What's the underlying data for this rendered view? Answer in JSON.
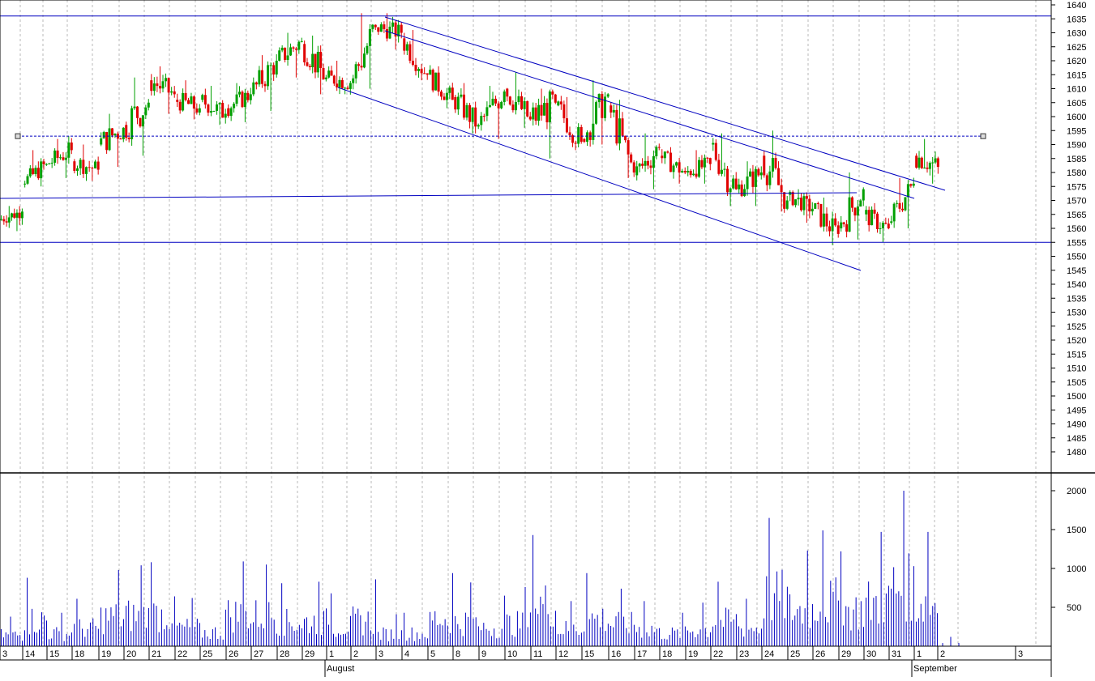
{
  "chart_data": [
    {
      "type": "candlestick",
      "panel": "price",
      "yticks": [
        1640,
        1635,
        1630,
        1625,
        1620,
        1615,
        1610,
        1605,
        1600,
        1595,
        1590,
        1585,
        1580,
        1575,
        1570,
        1565,
        1560,
        1555,
        1550,
        1545,
        1540,
        1535,
        1530,
        1525,
        1520,
        1515,
        1510,
        1505,
        1500,
        1495,
        1490,
        1485,
        1480
      ],
      "ylim": [
        1475,
        1641
      ],
      "day_labels": [
        "3",
        "14",
        "15",
        "18",
        "19",
        "20",
        "21",
        "22",
        "25",
        "26",
        "27",
        "28",
        "29",
        "1",
        "2",
        "3",
        "4",
        "5",
        "8",
        "9",
        "10",
        "11",
        "12",
        "15",
        "16",
        "17",
        "18",
        "19",
        "22",
        "23",
        "24",
        "25",
        "26",
        "29",
        "30",
        "31",
        "1",
        "2",
        "3"
      ],
      "month_labels": [
        "August",
        "September"
      ],
      "daily_ohlc": [
        {
          "d": "13",
          "o": 1563,
          "h": 1568,
          "l": 1559,
          "c": 1566
        },
        {
          "d": "14",
          "o": 1576,
          "h": 1588,
          "l": 1575,
          "c": 1583
        },
        {
          "d": "15",
          "o": 1583,
          "h": 1592,
          "l": 1578,
          "c": 1588
        },
        {
          "d": "18",
          "o": 1584,
          "h": 1590,
          "l": 1577,
          "c": 1581
        },
        {
          "d": "19",
          "o": 1590,
          "h": 1601,
          "l": 1582,
          "c": 1596
        },
        {
          "d": "20",
          "o": 1597,
          "h": 1614,
          "l": 1586,
          "c": 1605
        },
        {
          "d": "21",
          "o": 1613,
          "h": 1618,
          "l": 1601,
          "c": 1608
        },
        {
          "d": "22",
          "o": 1606,
          "h": 1613,
          "l": 1599,
          "c": 1603
        },
        {
          "d": "25",
          "o": 1606,
          "h": 1611,
          "l": 1597,
          "c": 1601
        },
        {
          "d": "26",
          "o": 1603,
          "h": 1612,
          "l": 1598,
          "c": 1608
        },
        {
          "d": "27",
          "o": 1608,
          "h": 1622,
          "l": 1602,
          "c": 1620
        },
        {
          "d": "28",
          "o": 1620,
          "h": 1630,
          "l": 1614,
          "c": 1627
        },
        {
          "d": "29",
          "o": 1626,
          "h": 1629,
          "l": 1608,
          "c": 1614
        },
        {
          "d": "1",
          "o": 1614,
          "h": 1620,
          "l": 1608,
          "c": 1612
        },
        {
          "d": "2",
          "o": 1612,
          "h": 1637,
          "l": 1610,
          "c": 1632
        },
        {
          "d": "3",
          "o": 1632,
          "h": 1637,
          "l": 1624,
          "c": 1630
        },
        {
          "d": "4",
          "o": 1628,
          "h": 1631,
          "l": 1613,
          "c": 1615
        },
        {
          "d": "5",
          "o": 1615,
          "h": 1618,
          "l": 1603,
          "c": 1606
        },
        {
          "d": "8",
          "o": 1607,
          "h": 1612,
          "l": 1594,
          "c": 1597
        },
        {
          "d": "9",
          "o": 1597,
          "h": 1611,
          "l": 1592,
          "c": 1609
        },
        {
          "d": "10",
          "o": 1610,
          "h": 1616,
          "l": 1596,
          "c": 1599
        },
        {
          "d": "11",
          "o": 1599,
          "h": 1610,
          "l": 1585,
          "c": 1605
        },
        {
          "d": "12",
          "o": 1604,
          "h": 1607,
          "l": 1588,
          "c": 1591
        },
        {
          "d": "15",
          "o": 1592,
          "h": 1613,
          "l": 1590,
          "c": 1608
        },
        {
          "d": "16",
          "o": 1604,
          "h": 1606,
          "l": 1578,
          "c": 1580
        },
        {
          "d": "17",
          "o": 1579,
          "h": 1594,
          "l": 1574,
          "c": 1589
        },
        {
          "d": "18",
          "o": 1586,
          "h": 1589,
          "l": 1576,
          "c": 1580
        },
        {
          "d": "19",
          "o": 1580,
          "h": 1588,
          "l": 1576,
          "c": 1583
        },
        {
          "d": "22",
          "o": 1590,
          "h": 1594,
          "l": 1568,
          "c": 1574
        },
        {
          "d": "23",
          "o": 1574,
          "h": 1584,
          "l": 1568,
          "c": 1580
        },
        {
          "d": "24",
          "o": 1586,
          "h": 1595,
          "l": 1566,
          "c": 1570
        },
        {
          "d": "25",
          "o": 1572,
          "h": 1574,
          "l": 1562,
          "c": 1567
        },
        {
          "d": "26",
          "o": 1567,
          "h": 1571,
          "l": 1554,
          "c": 1558
        },
        {
          "d": "29",
          "o": 1560,
          "h": 1580,
          "l": 1556,
          "c": 1574
        },
        {
          "d": "30",
          "o": 1565,
          "h": 1569,
          "l": 1555,
          "c": 1560
        },
        {
          "d": "31",
          "o": 1562,
          "h": 1578,
          "l": 1560,
          "c": 1576
        },
        {
          "d": "1",
          "o": 1586,
          "h": 1592,
          "l": 1576,
          "c": 1582
        }
      ],
      "horizontal_levels": [
        1636,
        1555
      ],
      "dotted_level": 1593,
      "series_colors": {
        "up": "#00a000",
        "down": "#e00000",
        "lines": "#0000c0",
        "grid": "#b0b0b0"
      }
    },
    {
      "type": "bar",
      "panel": "volume",
      "yticks": [
        2000,
        1500,
        1000,
        500
      ],
      "ylim": [
        0,
        2200
      ],
      "daily_volume_peaks": [
        {
          "d": "13",
          "v": 380
        },
        {
          "d": "14",
          "v": 880
        },
        {
          "d": "15",
          "v": 430
        },
        {
          "d": "18",
          "v": 610
        },
        {
          "d": "19",
          "v": 980
        },
        {
          "d": "20",
          "v": 1040
        },
        {
          "d": "21",
          "v": 1080
        },
        {
          "d": "22",
          "v": 620
        },
        {
          "d": "25",
          "v": 470
        },
        {
          "d": "26",
          "v": 1090
        },
        {
          "d": "27",
          "v": 1050
        },
        {
          "d": "28",
          "v": 810
        },
        {
          "d": "29",
          "v": 830
        },
        {
          "d": "1",
          "v": 680
        },
        {
          "d": "2",
          "v": 860
        },
        {
          "d": "3",
          "v": 410
        },
        {
          "d": "4",
          "v": 430
        },
        {
          "d": "5",
          "v": 940
        },
        {
          "d": "8",
          "v": 820
        },
        {
          "d": "9",
          "v": 650
        },
        {
          "d": "10",
          "v": 760
        },
        {
          "d": "11",
          "v": 1430
        },
        {
          "d": "12",
          "v": 580
        },
        {
          "d": "15",
          "v": 940
        },
        {
          "d": "16",
          "v": 740
        },
        {
          "d": "17",
          "v": 580
        },
        {
          "d": "18",
          "v": 430
        },
        {
          "d": "19",
          "v": 560
        },
        {
          "d": "22",
          "v": 830
        },
        {
          "d": "23",
          "v": 610
        },
        {
          "d": "24",
          "v": 1650
        },
        {
          "d": "25",
          "v": 1230
        },
        {
          "d": "26",
          "v": 1490
        },
        {
          "d": "29",
          "v": 1220
        },
        {
          "d": "30",
          "v": 1470
        },
        {
          "d": "31",
          "v": 2000
        },
        {
          "d": "1",
          "v": 1470
        },
        {
          "d": "2",
          "v": 120
        }
      ],
      "bar_color": "#0000c0"
    }
  ]
}
